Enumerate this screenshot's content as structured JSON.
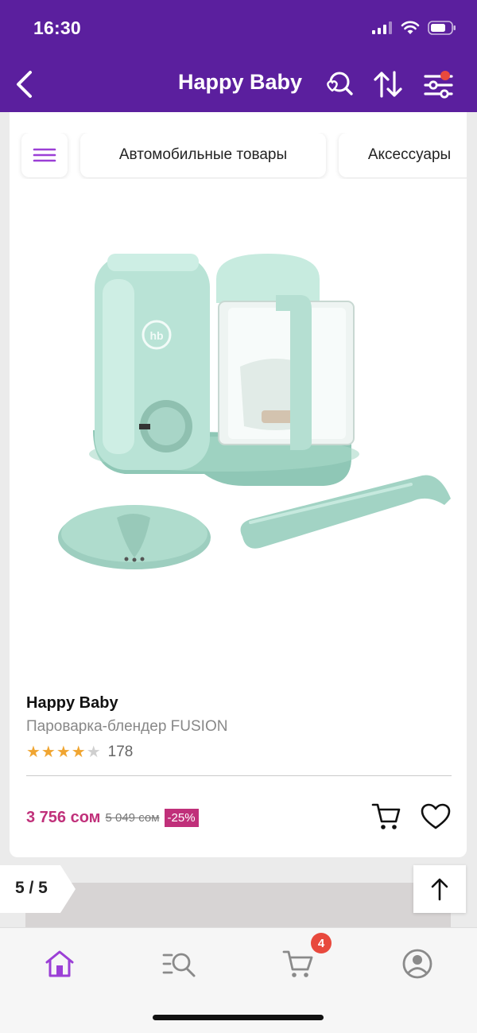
{
  "status_bar": {
    "time": "16:30"
  },
  "header": {
    "title": "Happy Baby",
    "back_icon": "chevron-left-icon",
    "icons": [
      "heart-search-icon",
      "sort-icon",
      "filter-icon"
    ],
    "accent": "#5b1f9e",
    "filter_dot_color": "#e8493d"
  },
  "chips": [
    {
      "label": "",
      "icon": "menu-icon"
    },
    {
      "label": "Автомобильные товары"
    },
    {
      "label": "Аксессуары"
    }
  ],
  "product": {
    "brand": "Happy Baby",
    "name": "Пароварка-блендер FUSION",
    "rating": 4,
    "rating_max": 5,
    "reviews_count": "178",
    "price": "3 756 сом",
    "old_price": "5 049 сом",
    "discount": "-25%",
    "price_color": "#c0307a",
    "image_logo_text": "hb"
  },
  "pager": {
    "label": "5 / 5"
  },
  "bottom_nav": {
    "items": [
      "home-icon",
      "catalog-search-icon",
      "cart-icon",
      "profile-icon"
    ],
    "cart_badge": "4",
    "active_color": "#9b3fd6"
  }
}
